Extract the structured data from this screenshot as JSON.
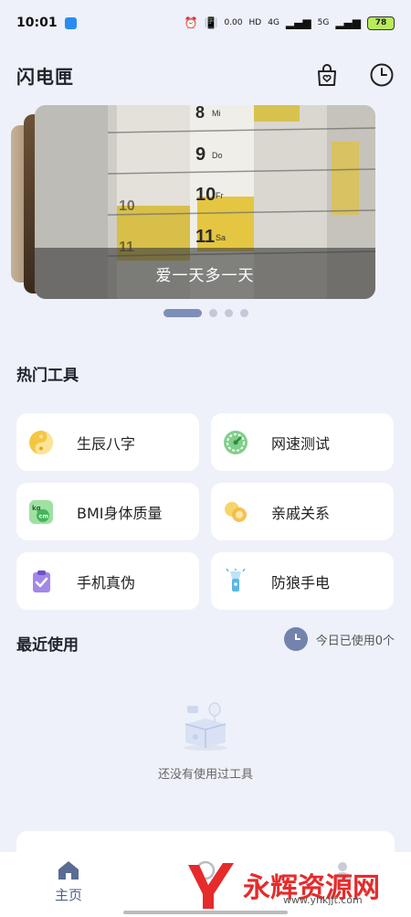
{
  "status_bar": {
    "time": "10:01",
    "net_speed": "0.00\nKB/s",
    "hd_label": "HD",
    "sig1": "4G",
    "sig2": "5G",
    "battery": "78"
  },
  "header": {
    "title": "闪电匣"
  },
  "banner": {
    "caption": "爱一天多一天",
    "page_count": 4,
    "active_index": 0
  },
  "hot_tools": {
    "title": "热门工具",
    "items": [
      {
        "label": "生辰八字",
        "icon": "yin-yang-icon"
      },
      {
        "label": "网速测试",
        "icon": "speedometer-icon"
      },
      {
        "label": "BMI身体质量",
        "icon": "bmi-scale-icon"
      },
      {
        "label": "亲戚关系",
        "icon": "relatives-icon"
      },
      {
        "label": "手机真伪",
        "icon": "clipboard-check-icon"
      },
      {
        "label": "防狼手电",
        "icon": "flashlight-icon"
      }
    ]
  },
  "recent": {
    "title": "最近使用",
    "usage_text": "今日已使用0个",
    "empty_text": "还没有使用过工具"
  },
  "nav": {
    "items": [
      {
        "label": "主页",
        "active": true
      },
      {
        "label": ""
      },
      {
        "label": ""
      }
    ]
  },
  "watermark": {
    "text": "永辉资源网",
    "url": "www.yhkjjt.com"
  },
  "colors": {
    "background": "#eef1f9",
    "accent": "#7383ad",
    "battery": "#b7eb5a"
  }
}
